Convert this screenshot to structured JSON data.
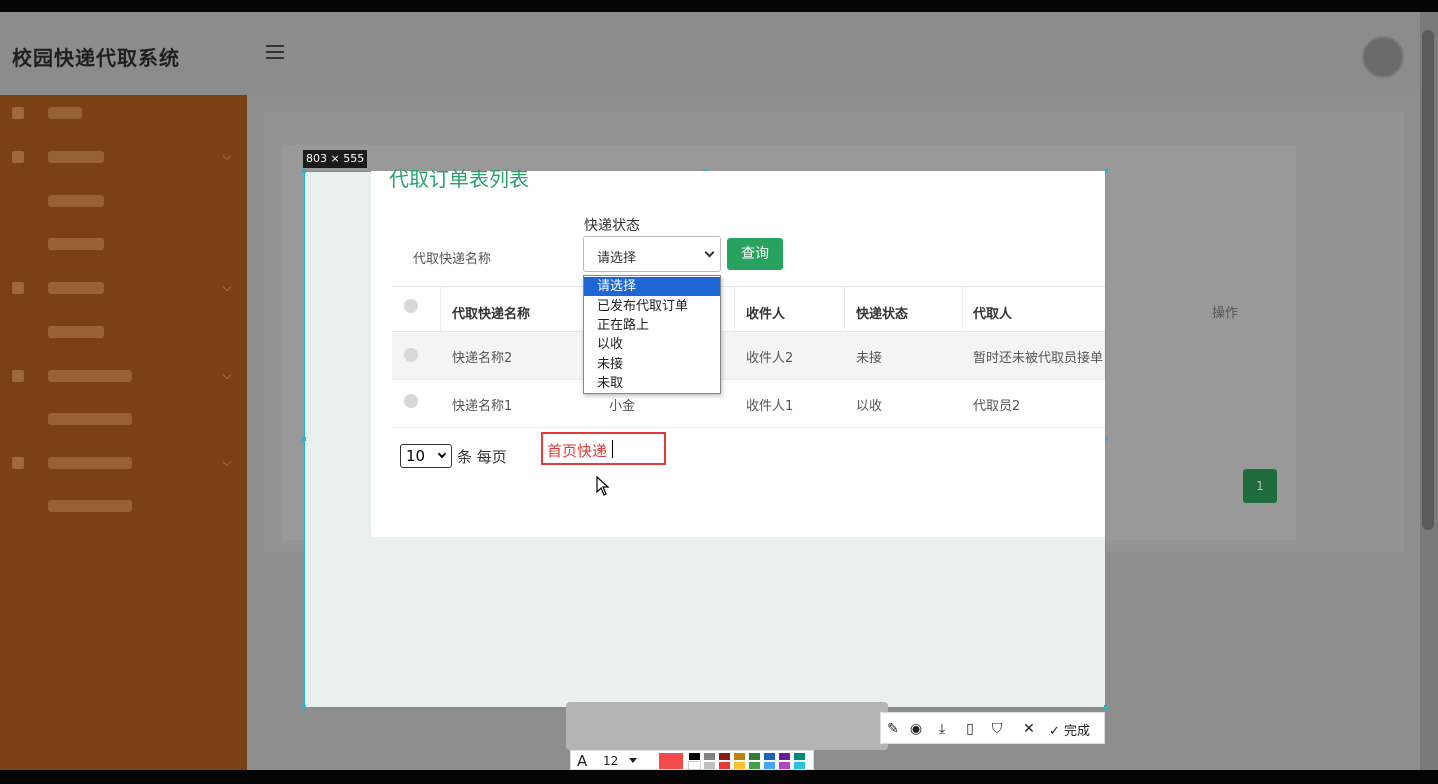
{
  "app": {
    "title": "校园快递代取系统"
  },
  "selection": {
    "size_label": "803 × 555"
  },
  "page": {
    "title": "代取订单表列表"
  },
  "filters": {
    "name_label": "代取快递名称",
    "status_label": "快递状态",
    "status_selected": "请选择",
    "status_options": [
      "请选择",
      "已发布代取订单",
      "正在路上",
      "以收",
      "未接",
      "未取"
    ],
    "query_button": "查询"
  },
  "table": {
    "headers": [
      "代取快递名称",
      "收件人",
      "快递状态",
      "代取人",
      "操作"
    ],
    "rows": [
      {
        "name": "快递名称2",
        "recipient": "收件人2",
        "status": "未接",
        "courier": "暂时还未被代取员接单"
      },
      {
        "name": "快递名称1",
        "sender": "小金",
        "recipient": "收件人1",
        "status": "以收",
        "courier": "代取员2"
      }
    ]
  },
  "pagination": {
    "page_size": "10",
    "per_page_label": "条 每页",
    "current_page": "1"
  },
  "annotation": {
    "text": "首页快递"
  },
  "screenshot_toolbar": {
    "done_label": "完成",
    "font_size": "12",
    "font_icon": "A",
    "current_color": "#f24b4b",
    "palette_top": [
      "#000000",
      "#808080",
      "#8b1a1a",
      "#b8860b",
      "#2e7d32",
      "#1e5fbf",
      "#6a1b9a",
      "#00897b"
    ],
    "palette_bottom": [
      "#ffffff",
      "#c0c0c0",
      "#e53935",
      "#fbc02d",
      "#43a047",
      "#42a5f5",
      "#ab47bc",
      "#26c6da"
    ]
  }
}
